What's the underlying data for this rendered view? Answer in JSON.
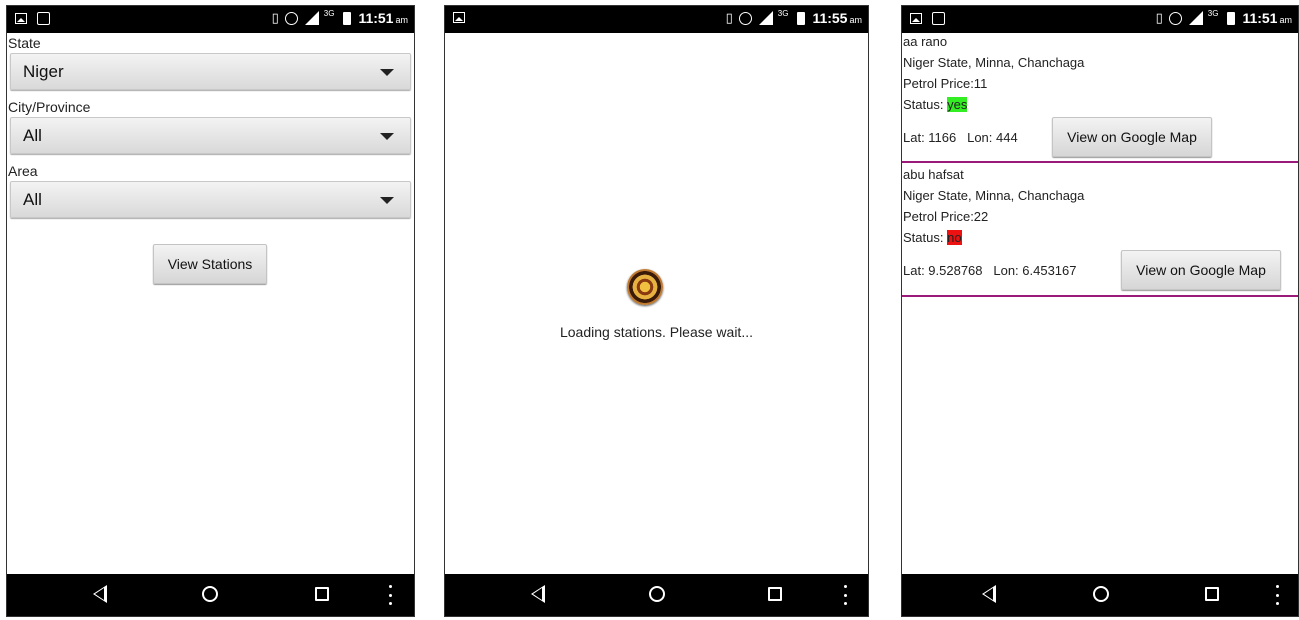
{
  "status_bar": [
    {
      "time": "11:51",
      "ampm": "am",
      "network": "3G"
    },
    {
      "time": "11:55",
      "ampm": "am",
      "network": "3G"
    },
    {
      "time": "11:51",
      "ampm": "am",
      "network": "3G"
    }
  ],
  "screen1": {
    "state_label": "State",
    "state_value": "Niger",
    "city_label": "City/Province",
    "city_value": "All",
    "area_label": "Area",
    "area_value": "All",
    "view_button": "View Stations"
  },
  "screen2": {
    "loading_text": "Loading stations. Please wait..."
  },
  "screen3": {
    "stations": [
      {
        "name": "aa rano",
        "address": "Niger State, Minna, Chanchaga",
        "price": "Petrol Price:11",
        "status_label": "Status:",
        "status_value": "yes",
        "coords": "Lat: 1166   Lon: 444",
        "map_button": "View on Google Map"
      },
      {
        "name": "abu hafsat",
        "address": "Niger State, Minna, Chanchaga",
        "price": "Petrol Price:22",
        "status_label": "Status:",
        "status_value": "no",
        "coords": "Lat: 9.528768   Lon: 6.453167",
        "map_button": "View on Google Map"
      }
    ]
  },
  "colors": {
    "status_yes": "#33ee22",
    "status_no": "#ee1111",
    "separator": "#9a1a7a"
  },
  "icons": [
    "image-icon",
    "map-icon",
    "vibrate-icon",
    "alarm-icon",
    "signal-icon",
    "battery-icon",
    "back-icon",
    "home-icon",
    "recents-icon",
    "more-icon"
  ]
}
